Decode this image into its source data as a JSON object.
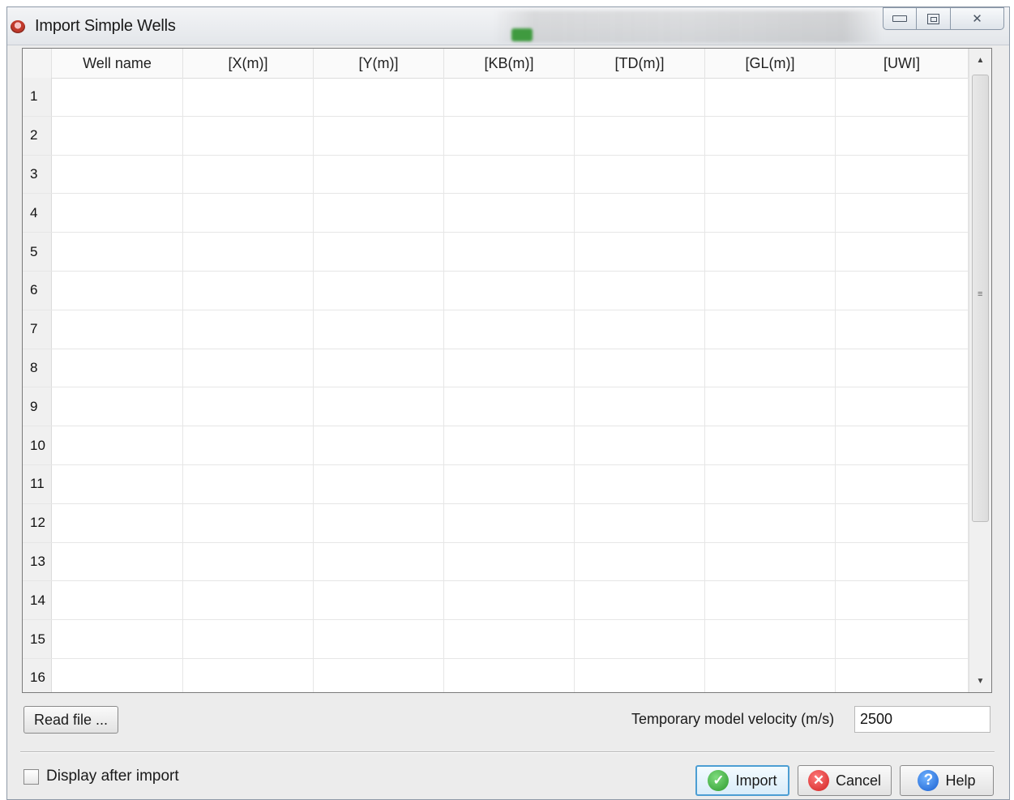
{
  "window": {
    "title": "Import Simple Wells",
    "controls": [
      "minimize",
      "maximize",
      "close"
    ]
  },
  "table": {
    "columns": [
      "Well name",
      "[X(m)]",
      "[Y(m)]",
      "[KB(m)]",
      "[TD(m)]",
      "[GL(m)]",
      "[UWI]"
    ],
    "row_numbers": [
      "1",
      "2",
      "3",
      "4",
      "5",
      "6",
      "7",
      "8",
      "9",
      "10",
      "11",
      "12",
      "13",
      "14",
      "15",
      "16"
    ]
  },
  "controls": {
    "read_file_label": "Read file ...",
    "velocity_label": "Temporary model velocity (m/s)",
    "velocity_value": "2500",
    "display_after_import_label": "Display after import",
    "display_after_import_checked": false
  },
  "buttons": {
    "import_label": "Import",
    "cancel_label": "Cancel",
    "help_label": "Help"
  },
  "colors": {
    "import_border": "#4c9ed3",
    "ok_icon": "#2e9a2e",
    "cancel_icon": "#d02020",
    "help_icon": "#1a5fd0"
  },
  "icons": {
    "app": "app-logo-icon",
    "import": "check-icon",
    "cancel": "x-circle-icon",
    "help": "question-icon"
  }
}
